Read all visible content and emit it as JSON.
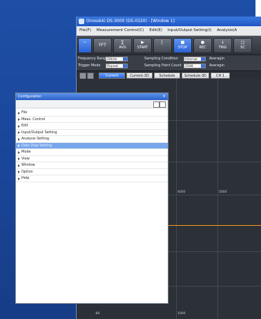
{
  "window": {
    "title": "Onosokki DS-3000 (DS-0320) - [Window 1]"
  },
  "menu": [
    "File(F)",
    "Measurement Control(C)",
    "Edit(E)",
    "Input/Output Setting(I)",
    "Analysis(A"
  ],
  "toolbar": {
    "fft_label": "FFT",
    "buttons": [
      {
        "label": "AVG",
        "glyph": "∑"
      },
      {
        "label": "START",
        "glyph": "▶"
      },
      {
        "label": "",
        "glyph": "▌"
      },
      {
        "label": "STOP",
        "glyph": "■"
      },
      {
        "label": "REC",
        "glyph": "●"
      },
      {
        "label": "TRIG",
        "glyph": "↓"
      },
      {
        "label": "SC",
        "glyph": "□"
      }
    ]
  },
  "params": {
    "freq_range_label": "Frequency Range",
    "freq_range_value": "20kHz",
    "trigger_mode_label": "Trigger Mode",
    "trigger_mode_value": "Repeat",
    "sampling_condition_label": "Sampling Condition",
    "sampling_condition_value": "Internal",
    "sampling_point_label": "Sampling Point Count",
    "sampling_point_value": "2048",
    "averaging_label_1": "Averagin",
    "averaging_label_2": "Averagin"
  },
  "tabs": [
    "Current",
    "Current-3D",
    "Schedule",
    "Schedule-3D",
    "CH 1"
  ],
  "graph": {
    "xticks": [
      "4000",
      "5000"
    ],
    "bottom_ticks": [
      "-80",
      "1000"
    ]
  },
  "config": {
    "title": "Configuration",
    "close_glyph": "×",
    "items": [
      "File",
      "Meas. Control",
      "Edit",
      "Input/Output Setting",
      "Analysis Setting",
      "Data Disp Setting",
      "Mode",
      "View",
      "Window",
      "Option",
      "Help"
    ],
    "selected_index": 5
  },
  "colors": {
    "accent": "#2b66d8",
    "selection": "#78a6ec",
    "desktop": "#1a4598"
  }
}
